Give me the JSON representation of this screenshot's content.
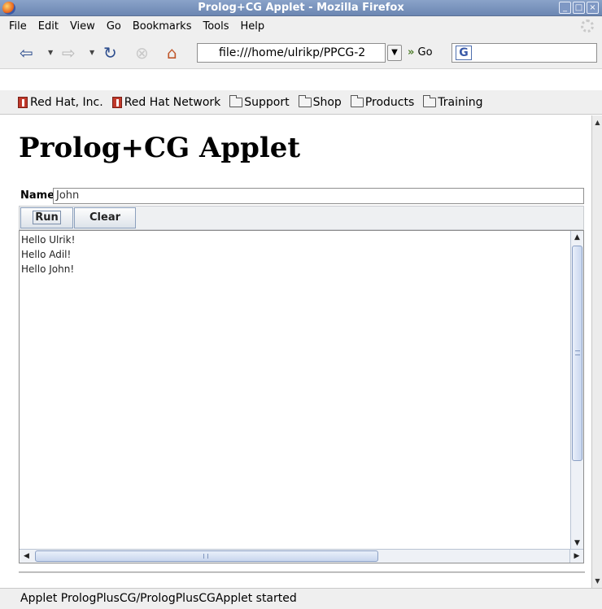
{
  "window": {
    "title": "Prolog+CG Applet - Mozilla Firefox",
    "controls": [
      "_",
      "□",
      "×"
    ]
  },
  "menubar": {
    "items": [
      {
        "label": "File"
      },
      {
        "label": "Edit"
      },
      {
        "label": "View"
      },
      {
        "label": "Go"
      },
      {
        "label": "Bookmarks"
      },
      {
        "label": "Tools"
      },
      {
        "label": "Help"
      }
    ]
  },
  "navbar": {
    "url": "file:///home/ulrikp/PPCG-2",
    "go_label": "Go",
    "search_value": ""
  },
  "bookmarks": {
    "items": [
      {
        "label": "Red Hat, Inc.",
        "icon": "bookmark-doc-icon"
      },
      {
        "label": "Red Hat Network",
        "icon": "bookmark-doc-icon"
      },
      {
        "label": "Support",
        "icon": "folder-icon"
      },
      {
        "label": "Shop",
        "icon": "folder-icon"
      },
      {
        "label": "Products",
        "icon": "folder-icon"
      },
      {
        "label": "Training",
        "icon": "folder-icon"
      }
    ]
  },
  "page": {
    "heading": "Prolog+CG Applet",
    "name_label": "Name",
    "name_value": "John",
    "run_label": "Run",
    "clear_label": "Clear",
    "output_lines": [
      "Hello Ulrik!",
      "Hello Adil!",
      "Hello John!"
    ]
  },
  "status": {
    "text": "Applet PrologPlusCG/PrologPlusCGApplet started"
  }
}
